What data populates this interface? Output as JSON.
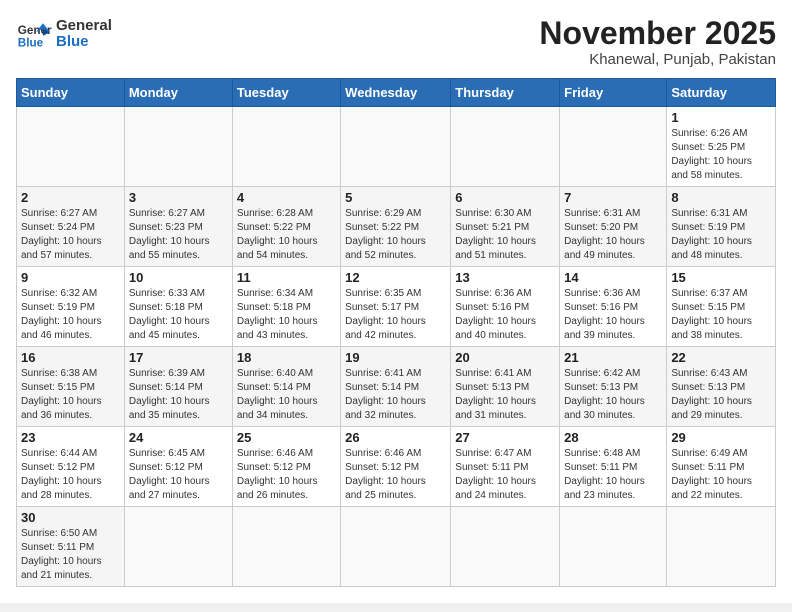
{
  "logo": {
    "general": "General",
    "blue": "Blue"
  },
  "header": {
    "month": "November 2025",
    "location": "Khanewal, Punjab, Pakistan"
  },
  "weekdays": [
    "Sunday",
    "Monday",
    "Tuesday",
    "Wednesday",
    "Thursday",
    "Friday",
    "Saturday"
  ],
  "days": [
    {
      "num": "",
      "info": ""
    },
    {
      "num": "",
      "info": ""
    },
    {
      "num": "",
      "info": ""
    },
    {
      "num": "",
      "info": ""
    },
    {
      "num": "",
      "info": ""
    },
    {
      "num": "",
      "info": ""
    },
    {
      "num": "1",
      "info": "Sunrise: 6:26 AM\nSunset: 5:25 PM\nDaylight: 10 hours\nand 58 minutes."
    },
    {
      "num": "2",
      "info": "Sunrise: 6:27 AM\nSunset: 5:24 PM\nDaylight: 10 hours\nand 57 minutes."
    },
    {
      "num": "3",
      "info": "Sunrise: 6:27 AM\nSunset: 5:23 PM\nDaylight: 10 hours\nand 55 minutes."
    },
    {
      "num": "4",
      "info": "Sunrise: 6:28 AM\nSunset: 5:22 PM\nDaylight: 10 hours\nand 54 minutes."
    },
    {
      "num": "5",
      "info": "Sunrise: 6:29 AM\nSunset: 5:22 PM\nDaylight: 10 hours\nand 52 minutes."
    },
    {
      "num": "6",
      "info": "Sunrise: 6:30 AM\nSunset: 5:21 PM\nDaylight: 10 hours\nand 51 minutes."
    },
    {
      "num": "7",
      "info": "Sunrise: 6:31 AM\nSunset: 5:20 PM\nDaylight: 10 hours\nand 49 minutes."
    },
    {
      "num": "8",
      "info": "Sunrise: 6:31 AM\nSunset: 5:19 PM\nDaylight: 10 hours\nand 48 minutes."
    },
    {
      "num": "9",
      "info": "Sunrise: 6:32 AM\nSunset: 5:19 PM\nDaylight: 10 hours\nand 46 minutes."
    },
    {
      "num": "10",
      "info": "Sunrise: 6:33 AM\nSunset: 5:18 PM\nDaylight: 10 hours\nand 45 minutes."
    },
    {
      "num": "11",
      "info": "Sunrise: 6:34 AM\nSunset: 5:18 PM\nDaylight: 10 hours\nand 43 minutes."
    },
    {
      "num": "12",
      "info": "Sunrise: 6:35 AM\nSunset: 5:17 PM\nDaylight: 10 hours\nand 42 minutes."
    },
    {
      "num": "13",
      "info": "Sunrise: 6:36 AM\nSunset: 5:16 PM\nDaylight: 10 hours\nand 40 minutes."
    },
    {
      "num": "14",
      "info": "Sunrise: 6:36 AM\nSunset: 5:16 PM\nDaylight: 10 hours\nand 39 minutes."
    },
    {
      "num": "15",
      "info": "Sunrise: 6:37 AM\nSunset: 5:15 PM\nDaylight: 10 hours\nand 38 minutes."
    },
    {
      "num": "16",
      "info": "Sunrise: 6:38 AM\nSunset: 5:15 PM\nDaylight: 10 hours\nand 36 minutes."
    },
    {
      "num": "17",
      "info": "Sunrise: 6:39 AM\nSunset: 5:14 PM\nDaylight: 10 hours\nand 35 minutes."
    },
    {
      "num": "18",
      "info": "Sunrise: 6:40 AM\nSunset: 5:14 PM\nDaylight: 10 hours\nand 34 minutes."
    },
    {
      "num": "19",
      "info": "Sunrise: 6:41 AM\nSunset: 5:14 PM\nDaylight: 10 hours\nand 32 minutes."
    },
    {
      "num": "20",
      "info": "Sunrise: 6:41 AM\nSunset: 5:13 PM\nDaylight: 10 hours\nand 31 minutes."
    },
    {
      "num": "21",
      "info": "Sunrise: 6:42 AM\nSunset: 5:13 PM\nDaylight: 10 hours\nand 30 minutes."
    },
    {
      "num": "22",
      "info": "Sunrise: 6:43 AM\nSunset: 5:13 PM\nDaylight: 10 hours\nand 29 minutes."
    },
    {
      "num": "23",
      "info": "Sunrise: 6:44 AM\nSunset: 5:12 PM\nDaylight: 10 hours\nand 28 minutes."
    },
    {
      "num": "24",
      "info": "Sunrise: 6:45 AM\nSunset: 5:12 PM\nDaylight: 10 hours\nand 27 minutes."
    },
    {
      "num": "25",
      "info": "Sunrise: 6:46 AM\nSunset: 5:12 PM\nDaylight: 10 hours\nand 26 minutes."
    },
    {
      "num": "26",
      "info": "Sunrise: 6:46 AM\nSunset: 5:12 PM\nDaylight: 10 hours\nand 25 minutes."
    },
    {
      "num": "27",
      "info": "Sunrise: 6:47 AM\nSunset: 5:11 PM\nDaylight: 10 hours\nand 24 minutes."
    },
    {
      "num": "28",
      "info": "Sunrise: 6:48 AM\nSunset: 5:11 PM\nDaylight: 10 hours\nand 23 minutes."
    },
    {
      "num": "29",
      "info": "Sunrise: 6:49 AM\nSunset: 5:11 PM\nDaylight: 10 hours\nand 22 minutes."
    },
    {
      "num": "30",
      "info": "Sunrise: 6:50 AM\nSunset: 5:11 PM\nDaylight: 10 hours\nand 21 minutes."
    }
  ]
}
